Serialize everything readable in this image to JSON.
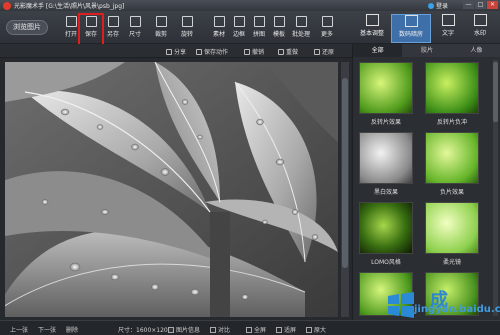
{
  "window": {
    "title": "光影魔术手 [G:\\生活\\照片\\风景\\psb_jpg]",
    "login_label": "登录",
    "controls": [
      "—",
      "□",
      "✕"
    ]
  },
  "toolbar": {
    "browse_label": "浏览图片",
    "tools": [
      {
        "label": "打开",
        "icon": "folder-icon"
      },
      {
        "label": "保存",
        "icon": "save-icon"
      },
      {
        "label": "另存",
        "icon": "save-as-icon"
      },
      {
        "label": "尺寸",
        "icon": "resize-icon"
      },
      {
        "label": "裁剪",
        "icon": "crop-icon"
      },
      {
        "label": "旋转",
        "icon": "rotate-icon"
      },
      {
        "label": "素材",
        "icon": "material-icon"
      },
      {
        "label": "边框",
        "icon": "border-icon"
      },
      {
        "label": "拼图",
        "icon": "collage-icon"
      },
      {
        "label": "模板",
        "icon": "template-icon"
      },
      {
        "label": "批处理",
        "icon": "batch-icon"
      },
      {
        "label": "更多",
        "icon": "more-icon"
      }
    ],
    "modes": [
      {
        "label": "基本调整",
        "active": false
      },
      {
        "label": "数码暗房",
        "active": true
      },
      {
        "label": "文字",
        "active": false
      },
      {
        "label": "水印",
        "active": false
      }
    ]
  },
  "actionbar": {
    "share": "分享",
    "save_action": "保存动作",
    "undo": "撤销",
    "redo": "重做",
    "restore": "还原"
  },
  "panel": {
    "tabs": [
      "全部",
      "胶片",
      "人像"
    ],
    "effects": [
      {
        "label": "反转片效果",
        "tone": "green"
      },
      {
        "label": "反转片负冲",
        "tone": "green"
      },
      {
        "label": "黑白效果",
        "tone": "gray"
      },
      {
        "label": "负片效果",
        "tone": "green"
      },
      {
        "label": "LOMO风格",
        "tone": "dark"
      },
      {
        "label": "柔光镜",
        "tone": "bright"
      },
      {
        "label": "",
        "tone": "green"
      },
      {
        "label": "",
        "tone": "green"
      }
    ]
  },
  "statusbar": {
    "prev": "上一张",
    "next": "下一张",
    "delete": "删除",
    "size": "尺寸：1600×1200",
    "info": "图片信息",
    "compare": "对比",
    "fit": "全屏",
    "actual": "适屏",
    "original": "原大"
  },
  "watermark": {
    "site": "jingyan.baidu.com",
    "cn": "成"
  }
}
